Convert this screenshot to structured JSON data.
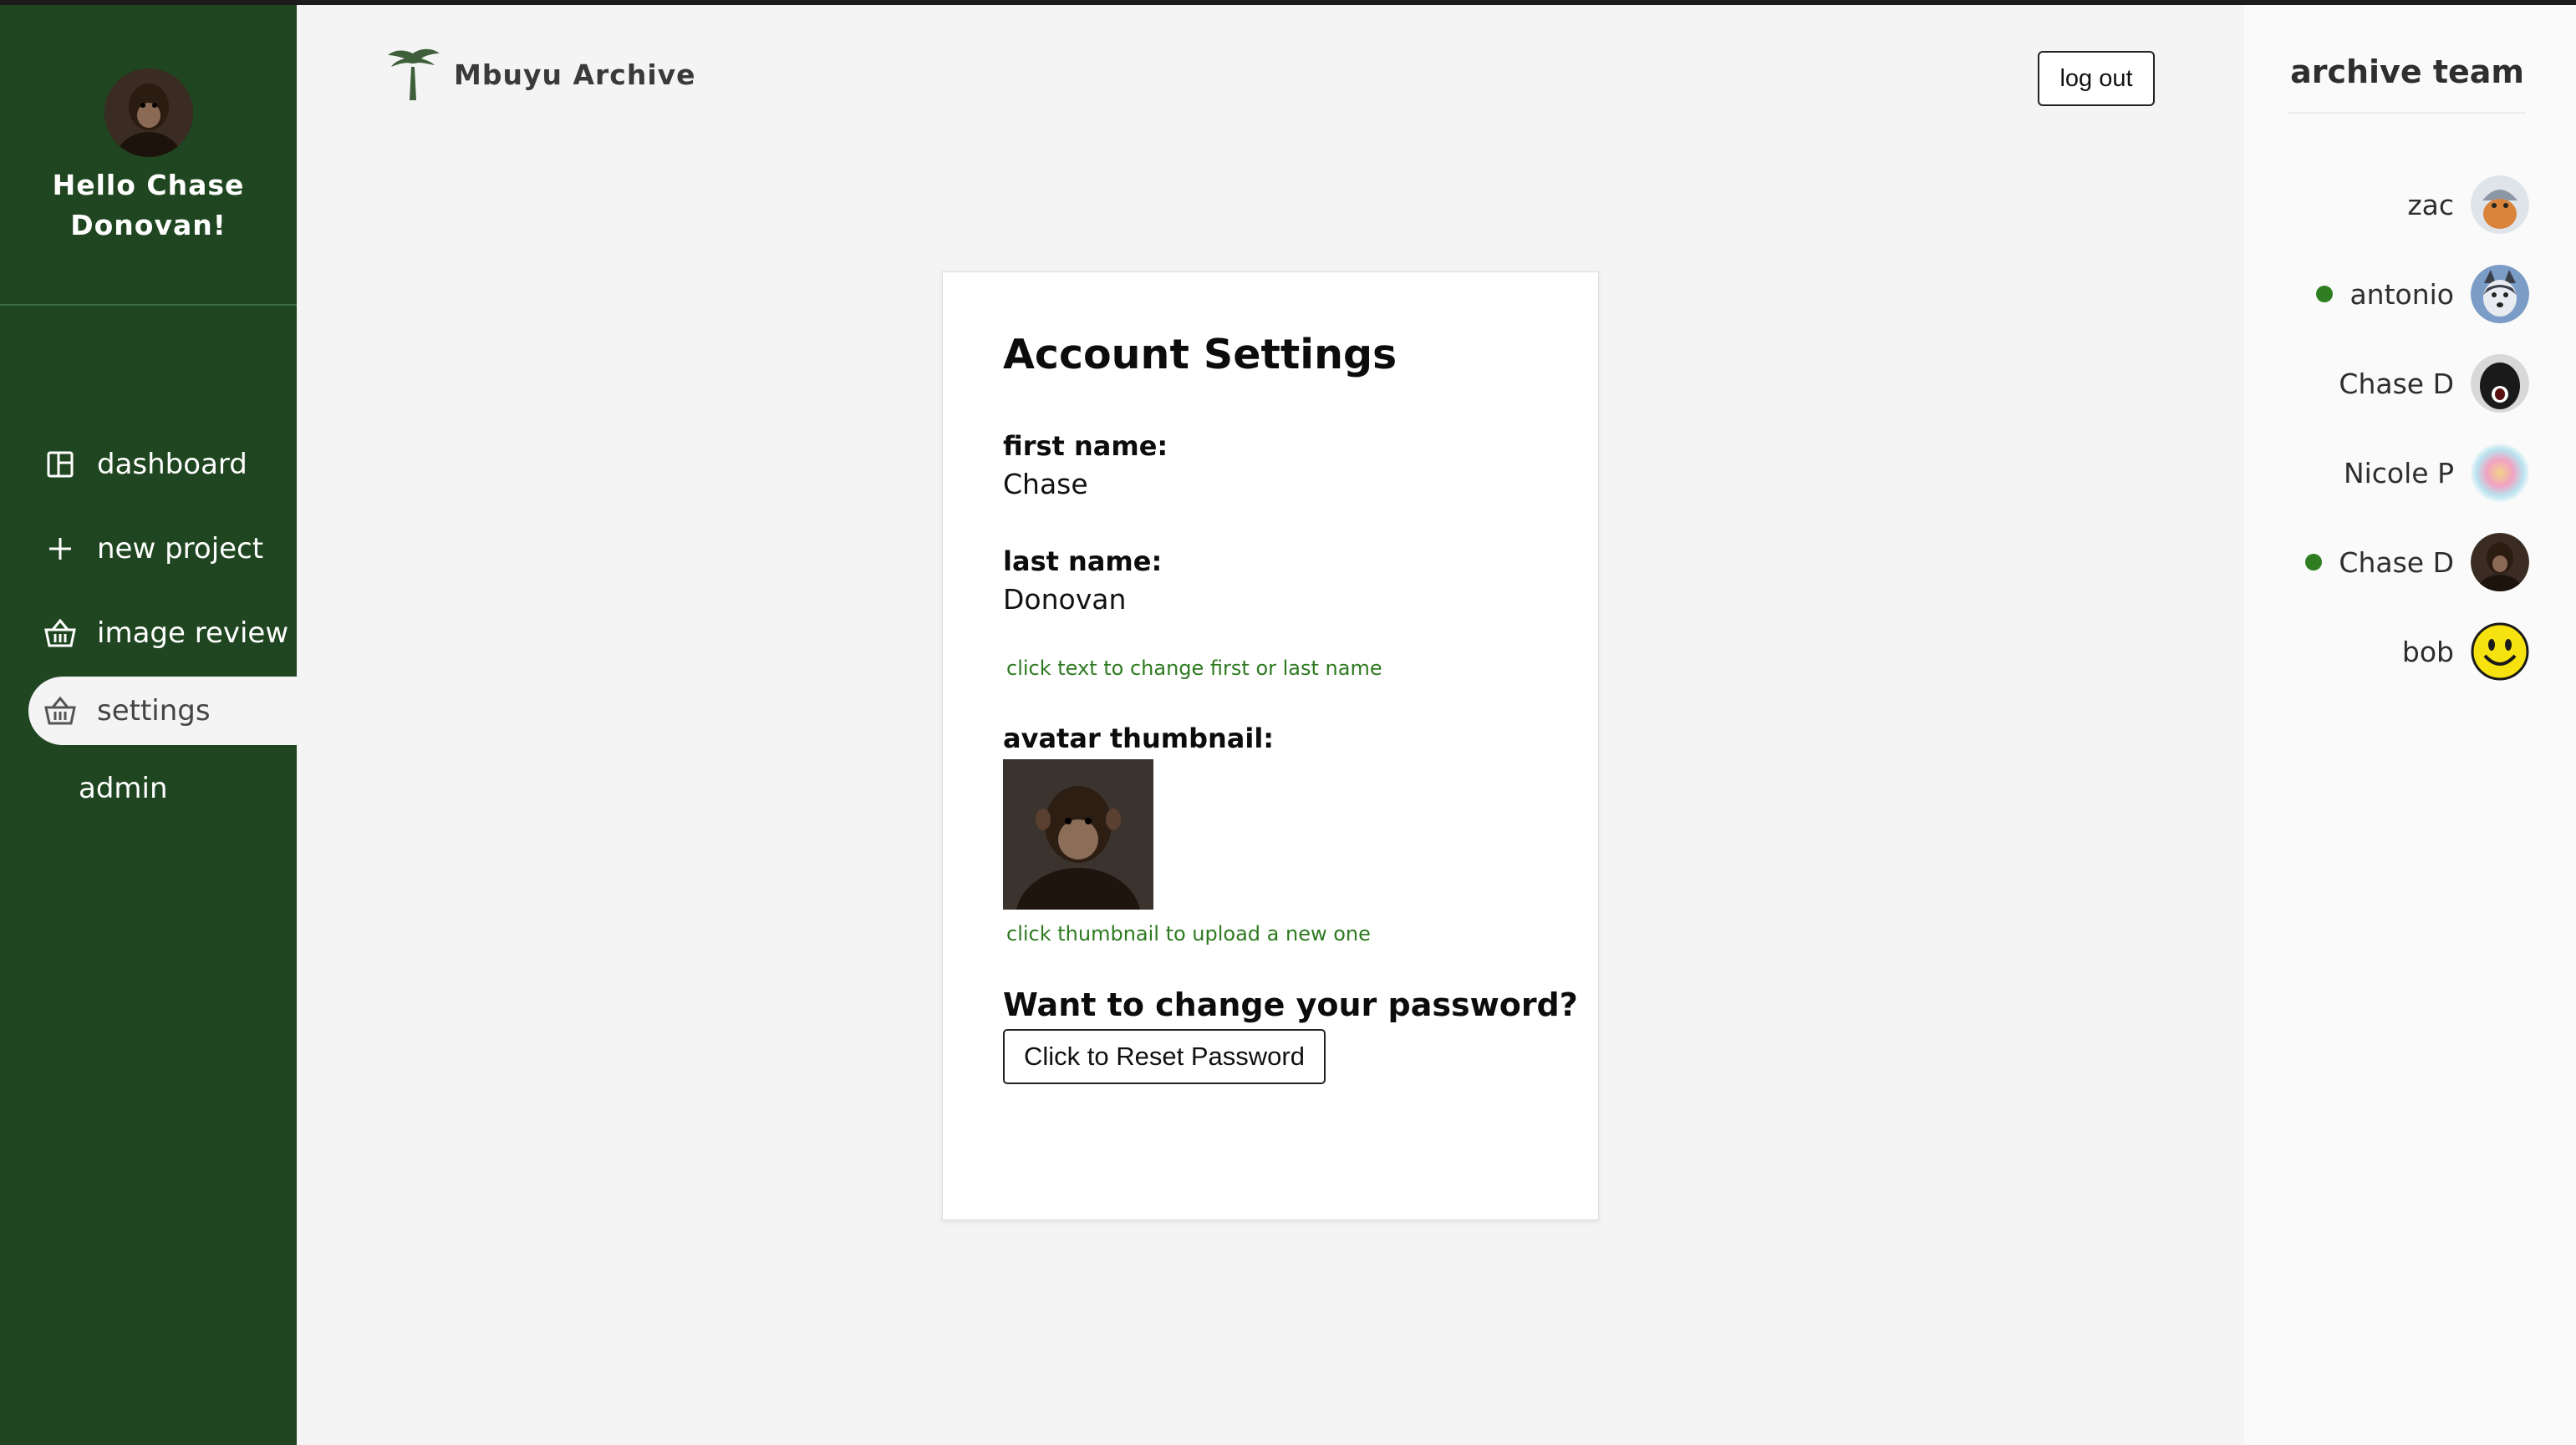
{
  "sidebar": {
    "greeting": "Hello Chase Donovan!",
    "items": [
      {
        "label": "dashboard",
        "icon": "dashboard-icon"
      },
      {
        "label": "new project",
        "icon": "plus-icon"
      },
      {
        "label": "image review",
        "icon": "basket-icon"
      },
      {
        "label": "settings",
        "icon": "basket-icon",
        "active": true
      }
    ],
    "admin_label": "admin"
  },
  "header": {
    "brand": "Mbuyu Archive",
    "logout_label": "log out"
  },
  "account": {
    "title": "Account Settings",
    "first_name_label": "first name:",
    "first_name": "Chase",
    "last_name_label": "last name:",
    "last_name": "Donovan",
    "name_hint": "click text to change first or last name",
    "avatar_label": "avatar thumbnail:",
    "avatar_hint": "click thumbnail to upload a new one",
    "password_heading": "Want to change your password?",
    "reset_label": "Click to Reset Password"
  },
  "team": {
    "title": "archive team",
    "members": [
      {
        "name": "zac",
        "online": false,
        "avatar": "viking-avatar"
      },
      {
        "name": "antonio",
        "online": true,
        "avatar": "husky-avatar"
      },
      {
        "name": "Chase D",
        "online": false,
        "avatar": "gorilla-avatar"
      },
      {
        "name": "Nicole P",
        "online": false,
        "avatar": "gradient-avatar"
      },
      {
        "name": "Chase D",
        "online": true,
        "avatar": "chimp-avatar"
      },
      {
        "name": "bob",
        "online": false,
        "avatar": "smiley-avatar"
      }
    ]
  },
  "colors": {
    "sidebar_bg": "#1f4620",
    "accent_green": "#2d7a1f",
    "online_dot": "#2f7d21",
    "page_bg": "#f4f4f4"
  }
}
